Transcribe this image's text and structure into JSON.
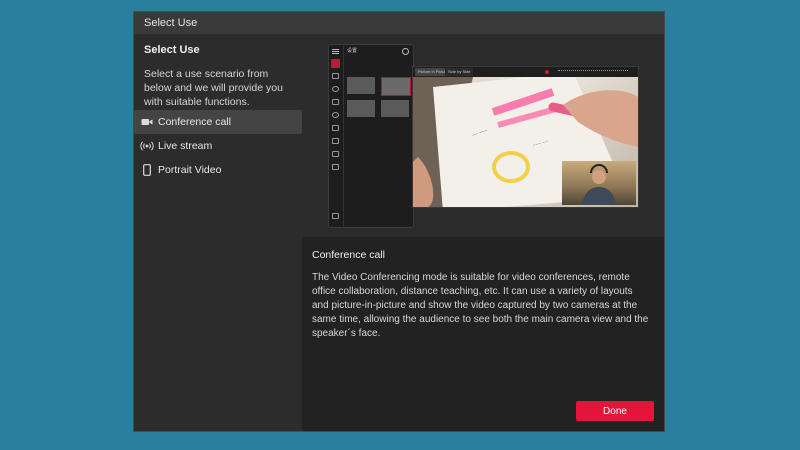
{
  "dialog": {
    "title": "Select Use"
  },
  "sidebar": {
    "heading": "Select Use",
    "description": "Select a use scenario from below and we will provide you with suitable functions.",
    "items": [
      {
        "label": "Conference call",
        "icon": "video-camera-icon",
        "active": true
      },
      {
        "label": "Live stream",
        "icon": "broadcast-icon",
        "active": false
      },
      {
        "label": "Portrait Video",
        "icon": "phone-portrait-icon",
        "active": false
      }
    ]
  },
  "preview": {
    "panel_title": "设置",
    "video_tabs": [
      "Picture in Picture",
      "Side by Side"
    ]
  },
  "content": {
    "title": "Conference call",
    "description": "The Video Conferencing mode is suitable for video conferences, remote office collaboration, distance teaching, etc. It can use a variety of layouts and picture-in-picture and show the video captured by two cameras at the same time, allowing the audience to see both the main camera view and the speaker´s face."
  },
  "actions": {
    "done_label": "Done"
  },
  "colors": {
    "accent": "#e3153a",
    "background": "#2b7f9e",
    "dialog": "#262626",
    "active_item": "#444444"
  }
}
